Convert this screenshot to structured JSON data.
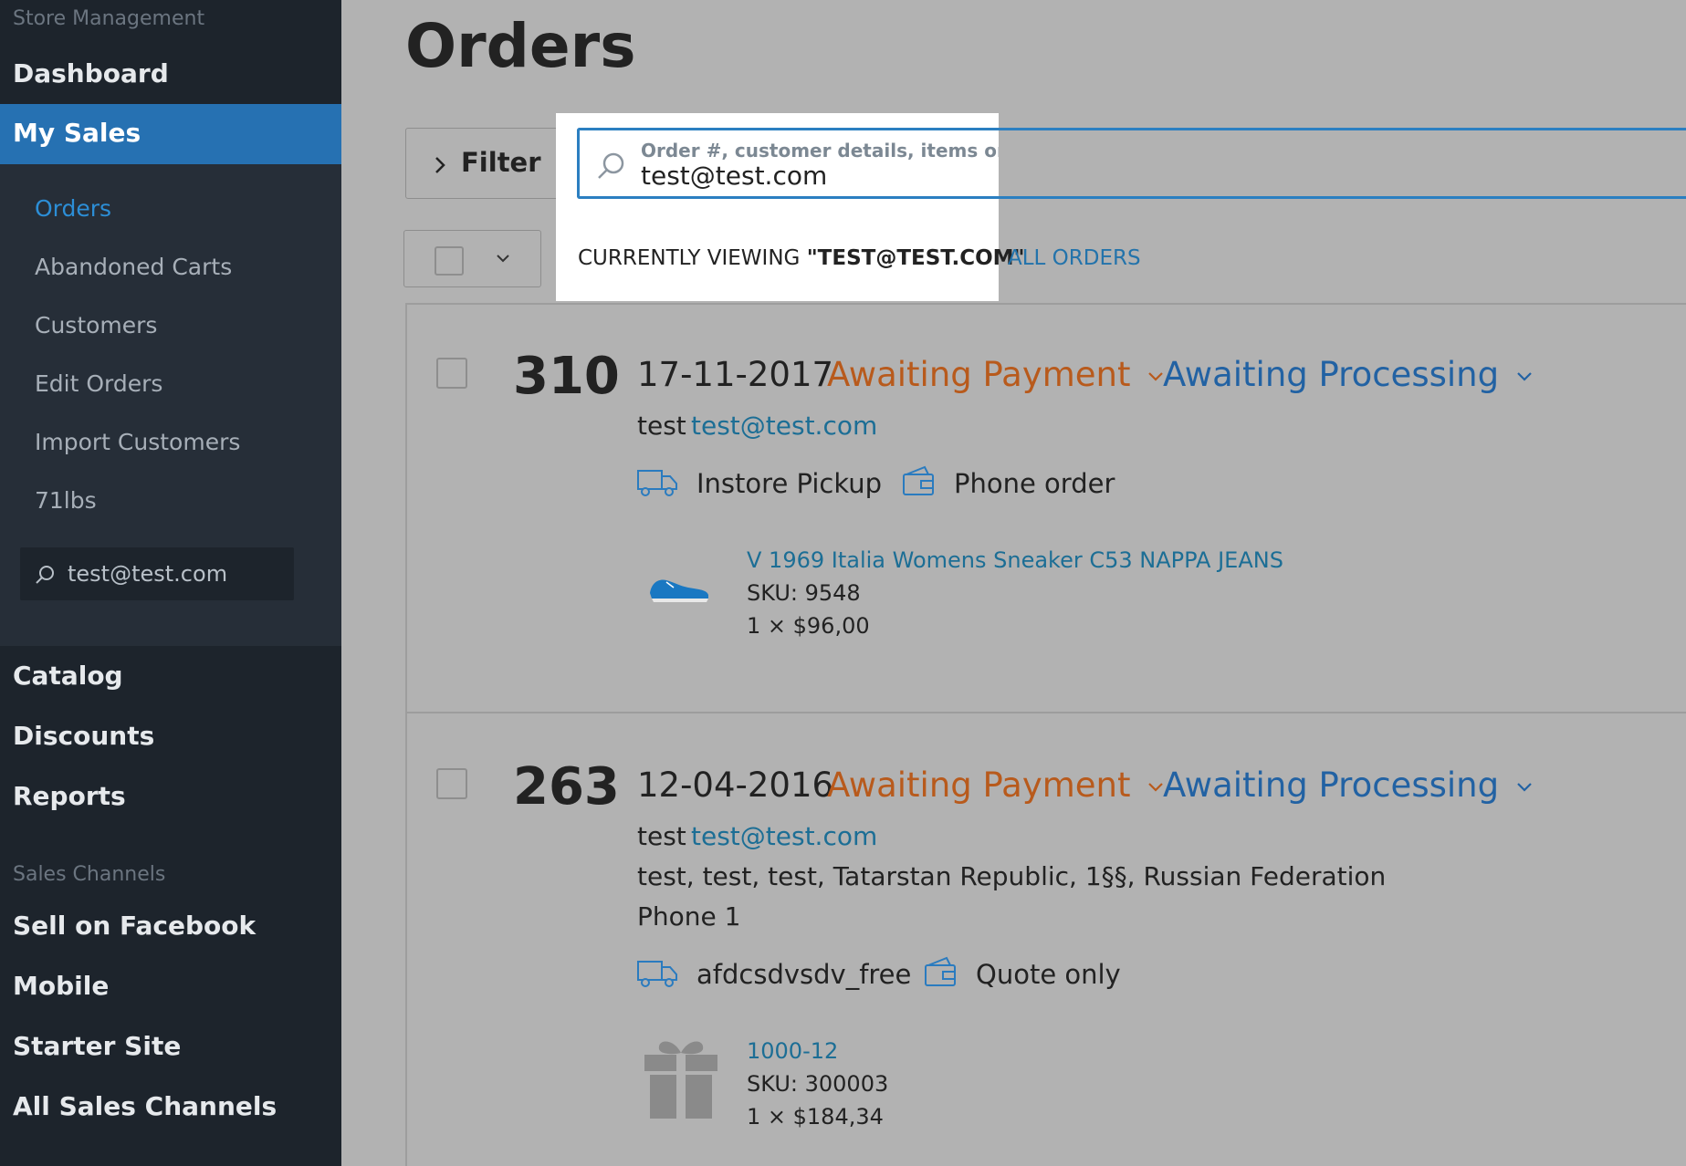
{
  "sidebar": {
    "section_store": "Store Management",
    "dashboard": "Dashboard",
    "my_sales": "My Sales",
    "sub_items": [
      "Orders",
      "Abandoned Carts",
      "Customers",
      "Edit Orders",
      "Import Customers",
      "71lbs"
    ],
    "search_value": "test@test.com",
    "catalog": "Catalog",
    "discounts": "Discounts",
    "reports": "Reports",
    "section_channels": "Sales Channels",
    "channels": [
      "Sell on Facebook",
      "Mobile",
      "Starter Site",
      "All Sales Channels"
    ]
  },
  "main": {
    "title": "Orders",
    "filter_label": "Filter",
    "search_placeholder": "Order #, customer details, items ordered",
    "search_value": "test@test.com",
    "viewing_prefix": "CURRENTLY VIEWING ",
    "viewing_query": "\"TEST@TEST.COM\"",
    "all_orders_link": "ALL ORDERS"
  },
  "orders": [
    {
      "number": "310",
      "date": "17-11-2017",
      "payment_status": "Awaiting Payment",
      "processing_status": "Awaiting Processing",
      "customer_name": "test",
      "customer_email": "test@test.com",
      "shipping_method": "Instore Pickup",
      "payment_method": "Phone order",
      "product": {
        "name": "V 1969 Italia Womens Sneaker C53 NAPPA JEANS",
        "sku": "SKU: 9548",
        "price": "1 × $96,00"
      }
    },
    {
      "number": "263",
      "date": "12-04-2016",
      "payment_status": "Awaiting Payment",
      "processing_status": "Awaiting Processing",
      "customer_name": "test",
      "customer_email": "test@test.com",
      "address": "test, test, test, Tatarstan Republic, 1§§, Russian Federation",
      "phone": "Phone 1",
      "shipping_method": "afdcsdvsdv_free",
      "payment_method": "Quote only",
      "product": {
        "name": "1000-12",
        "sku": "SKU: 300003",
        "price": "1 × $184,34"
      }
    }
  ],
  "colors": {
    "sidebar_bg": "#1d242c",
    "sidebar_active": "#2671b2",
    "payment_status": "#b85a1c",
    "processing_status": "#2262a3",
    "link": "#1c6e95"
  }
}
